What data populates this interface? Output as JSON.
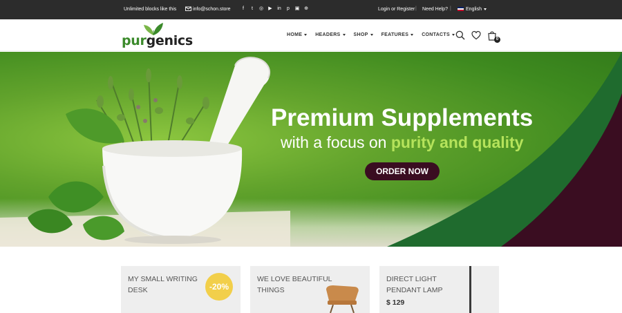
{
  "topbar": {
    "tagline": "Unlimited blocks like this",
    "email": "info@schon.store",
    "social_icons": [
      "facebook-icon",
      "twitter-icon",
      "instagram-icon",
      "youtube-icon",
      "linkedin-icon",
      "pinterest-icon",
      "flickr-icon",
      "foursquare-icon"
    ],
    "social_glyphs": [
      "f",
      "t",
      "◎",
      "▶",
      "in",
      "p",
      "▣",
      "⊕"
    ],
    "login": "Login or Register",
    "help": "Need Help?",
    "language": "English",
    "sep": "|"
  },
  "logo": {
    "part1": "pur",
    "part2": "genics"
  },
  "nav": {
    "items": [
      "HOME",
      "HEADERS",
      "SHOP",
      "FEATURES",
      "CONTACTS"
    ]
  },
  "cart": {
    "count": "0"
  },
  "hero": {
    "title": "Premium Supplements",
    "subtitle_prefix": "with a focus on ",
    "subtitle_highlight": "purity and quality",
    "button": "ORDER NOW"
  },
  "cards": [
    {
      "title": "MY SMALL WRITING DESK",
      "badge": "-20%"
    },
    {
      "title": "WE LOVE BEAUTIFUL THINGS"
    },
    {
      "title": "DIRECT LIGHT PENDANT LAMP",
      "price": "$ 129"
    }
  ],
  "colors": {
    "topbar": "#2c2c2c",
    "brand_green": "#3b8a2b",
    "hero_green": "#62a32c",
    "button_plum": "#3a0d21",
    "highlight": "#b5e35b",
    "badge_yellow": "#f2cf4a"
  }
}
